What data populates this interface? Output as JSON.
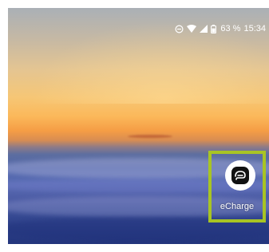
{
  "status_bar": {
    "icons": [
      "do-not-disturb-icon",
      "wifi-icon",
      "cell-signal-icon",
      "battery-icon"
    ],
    "battery_percent": "63 %",
    "time": "15:34"
  },
  "home_screen": {
    "apps": [
      {
        "label": "eCharge",
        "icon": "echarge-app-icon",
        "highlighted": true,
        "highlight_color": "#a8c424"
      }
    ]
  }
}
